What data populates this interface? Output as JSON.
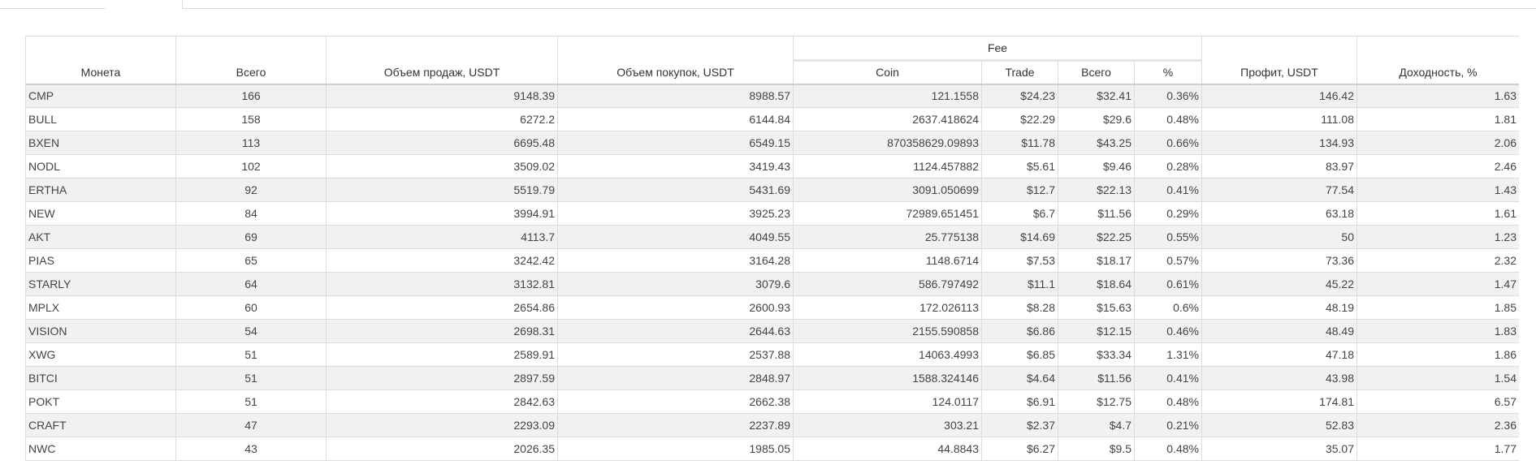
{
  "table": {
    "headers": {
      "coin": "Монета",
      "total": "Всего",
      "sell_volume": "Объем продаж, USDT",
      "buy_volume": "Объем покупок, USDT",
      "fee_group": "Fee",
      "fee_coin": "Coin",
      "fee_trade": "Trade",
      "fee_total": "Всего",
      "fee_percent": "%",
      "profit": "Профит, USDT",
      "yield": "Доходность, %"
    },
    "rows": [
      [
        "CMP",
        "166",
        "9148.39",
        "8988.57",
        "121.1558",
        "$24.23",
        "$32.41",
        "0.36%",
        "146.42",
        "1.63"
      ],
      [
        "BULL",
        "158",
        "6272.2",
        "6144.84",
        "2637.418624",
        "$22.29",
        "$29.6",
        "0.48%",
        "111.08",
        "1.81"
      ],
      [
        "BXEN",
        "113",
        "6695.48",
        "6549.15",
        "870358629.09893",
        "$11.78",
        "$43.25",
        "0.66%",
        "134.93",
        "2.06"
      ],
      [
        "NODL",
        "102",
        "3509.02",
        "3419.43",
        "1124.457882",
        "$5.61",
        "$9.46",
        "0.28%",
        "83.97",
        "2.46"
      ],
      [
        "ERTHA",
        "92",
        "5519.79",
        "5431.69",
        "3091.050699",
        "$12.7",
        "$22.13",
        "0.41%",
        "77.54",
        "1.43"
      ],
      [
        "NEW",
        "84",
        "3994.91",
        "3925.23",
        "72989.651451",
        "$6.7",
        "$11.56",
        "0.29%",
        "63.18",
        "1.61"
      ],
      [
        "AKT",
        "69",
        "4113.7",
        "4049.55",
        "25.775138",
        "$14.69",
        "$22.25",
        "0.55%",
        "50",
        "1.23"
      ],
      [
        "PIAS",
        "65",
        "3242.42",
        "3164.28",
        "1148.6714",
        "$7.53",
        "$18.17",
        "0.57%",
        "73.36",
        "2.32"
      ],
      [
        "STARLY",
        "64",
        "3132.81",
        "3079.6",
        "586.797492",
        "$11.1",
        "$18.64",
        "0.61%",
        "45.22",
        "1.47"
      ],
      [
        "MPLX",
        "60",
        "2654.86",
        "2600.93",
        "172.026113",
        "$8.28",
        "$15.63",
        "0.6%",
        "48.19",
        "1.85"
      ],
      [
        "VISION",
        "54",
        "2698.31",
        "2644.63",
        "2155.590858",
        "$6.86",
        "$12.15",
        "0.46%",
        "48.49",
        "1.83"
      ],
      [
        "XWG",
        "51",
        "2589.91",
        "2537.88",
        "14063.4993",
        "$6.85",
        "$33.34",
        "1.31%",
        "47.18",
        "1.86"
      ],
      [
        "BITCI",
        "51",
        "2897.59",
        "2848.97",
        "1588.324146",
        "$4.64",
        "$11.56",
        "0.41%",
        "43.98",
        "1.54"
      ],
      [
        "POKT",
        "51",
        "2842.63",
        "2662.38",
        "124.0117",
        "$6.91",
        "$12.75",
        "0.48%",
        "174.81",
        "6.57"
      ],
      [
        "CRAFT",
        "47",
        "2293.09",
        "2237.89",
        "303.21",
        "$2.37",
        "$4.7",
        "0.21%",
        "52.83",
        "2.36"
      ],
      [
        "NWC",
        "43",
        "2026.35",
        "1985.05",
        "44.8843",
        "$6.27",
        "$9.5",
        "0.48%",
        "35.07",
        "1.77"
      ]
    ]
  }
}
